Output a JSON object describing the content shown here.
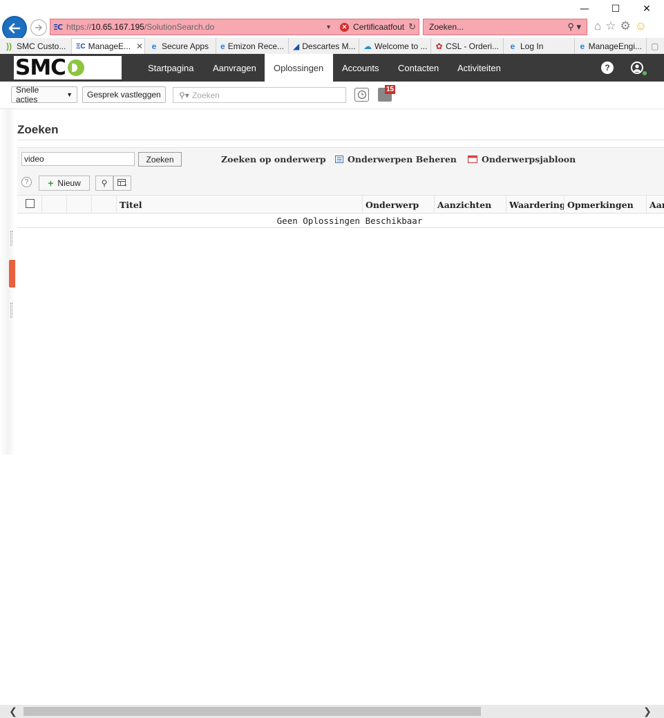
{
  "window": {
    "minimize_glyph": "—",
    "maximize_glyph": "☐",
    "close_glyph": "✕"
  },
  "browser": {
    "url_proto": "https://",
    "url_host": "10.65.167.195",
    "url_path": "/SolutionSearch.do",
    "cert_error": "Certificaatfout",
    "search_placeholder": "Zoeken...",
    "tabs": [
      {
        "label": "SMC Custo...",
        "icon": "smc-icon"
      },
      {
        "label": "ManageE...",
        "icon": "sc-icon",
        "active": true
      },
      {
        "label": "Secure Apps",
        "icon": "ie-icon"
      },
      {
        "label": "Emizon Rece...",
        "icon": "ie-icon"
      },
      {
        "label": "Descartes M...",
        "icon": "descartes-icon"
      },
      {
        "label": "Welcome to ...",
        "icon": "cloud-icon"
      },
      {
        "label": "CSL - Orderi...",
        "icon": "csl-icon"
      },
      {
        "label": "Log In",
        "icon": "ie-icon"
      },
      {
        "label": "ManageEngi...",
        "icon": "ie-icon"
      }
    ]
  },
  "app": {
    "logo_text": "SMC",
    "nav": [
      "Startpagina",
      "Aanvragen",
      "Oplossingen",
      "Accounts",
      "Contacten",
      "Activiteiten"
    ],
    "active_nav": "Oplossingen",
    "toolbar": {
      "quick_actions": "Snelle acties",
      "log_call": "Gesprek vastleggen",
      "search_placeholder": "Zoeken",
      "notification_count": "15"
    }
  },
  "page": {
    "title": "Zoeken",
    "search_value": "video",
    "search_button": "Zoeken",
    "links": {
      "by_topic": "Zoeken op onderwerp",
      "manage_topics": "Onderwerpen Beheren",
      "topic_template": "Onderwerpsjabloon"
    },
    "new_button": "Nieuw",
    "table": {
      "columns": [
        "Titel",
        "Onderwerp",
        "Aanzichten",
        "Waardering",
        "Opmerkingen",
        "Aan"
      ],
      "empty_message": "Geen Oplossingen Beschikbaar"
    }
  }
}
